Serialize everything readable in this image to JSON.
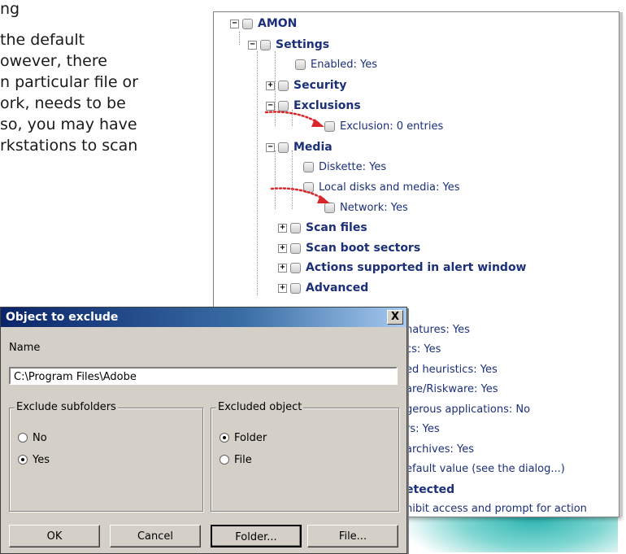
{
  "article": {
    "lines": [
      "ng",
      "the default",
      "owever, there",
      "n particular file or",
      "ork, needs to be",
      "so, you may have",
      "rkstations to scan"
    ]
  },
  "tree": {
    "root": "AMON",
    "settings": "Settings",
    "enabled": "Enabled: Yes",
    "security": "Security",
    "exclusions": "Exclusions",
    "exclusion_entries": "Exclusion: 0 entries",
    "media": "Media",
    "diskette": "Diskette: Yes",
    "local_disks": "Local disks and media: Yes",
    "network": "Network: Yes",
    "scan_files": "Scan files",
    "scan_boot": "Scan boot sectors",
    "actions_alert": "Actions supported in alert window",
    "advanced": "Advanced",
    "partial": [
      "natures: Yes",
      "cs: Yes",
      "ed heuristics: Yes",
      "are/Riskware: Yes",
      "gerous applications: No",
      "rs: Yes",
      "archives: Yes",
      "efault value (see the dialog...)",
      "etected",
      "hibit access and prompt for action"
    ]
  },
  "dialog": {
    "title": "Object to exclude",
    "close": "X",
    "name_label": "Name",
    "name_value": "C:\\Program Files\\Adobe",
    "subfolders": {
      "title": "Exclude subfolders",
      "options": [
        "No",
        "Yes"
      ],
      "selected": "Yes"
    },
    "object": {
      "title": "Excluded object",
      "options": [
        "Folder",
        "File"
      ],
      "selected": "Folder"
    },
    "buttons": {
      "ok": "OK",
      "cancel": "Cancel",
      "folder": "Folder...",
      "file": "File..."
    }
  },
  "colors": {
    "tree_text": "#1b2f7a",
    "arrow": "#d9262a",
    "title_bar": "#0a246a"
  }
}
